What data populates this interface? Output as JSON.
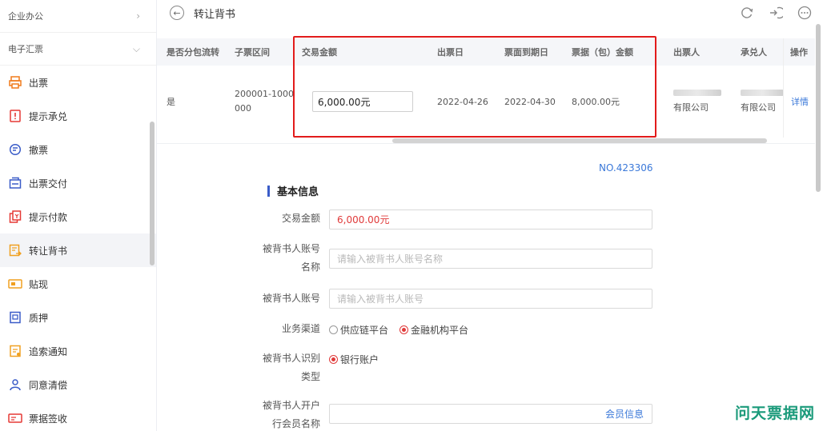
{
  "sidebar": {
    "groups": [
      {
        "label": "企业办公",
        "chevron": "›"
      },
      {
        "label": "电子汇票",
        "chevron": "⌄"
      }
    ],
    "items": [
      {
        "label": "出票",
        "icon": "printer-icon"
      },
      {
        "label": "提示承兑",
        "icon": "alert-doc-icon"
      },
      {
        "label": "撤票",
        "icon": "revoke-icon"
      },
      {
        "label": "出票交付",
        "icon": "deliver-icon"
      },
      {
        "label": "提示付款",
        "icon": "payment-icon"
      },
      {
        "label": "转让背书",
        "icon": "endorse-icon"
      },
      {
        "label": "贴现",
        "icon": "discount-icon"
      },
      {
        "label": "质押",
        "icon": "pledge-icon"
      },
      {
        "label": "追索通知",
        "icon": "recourse-icon"
      },
      {
        "label": "同意清偿",
        "icon": "agree-icon"
      },
      {
        "label": "票据签收",
        "icon": "sign-icon"
      }
    ],
    "active_index": 5
  },
  "header": {
    "title": "转让背书",
    "back": "←"
  },
  "table": {
    "columns": [
      "是否分包流转",
      "子票区间",
      "交易金额",
      "出票日",
      "票面到期日",
      "票据（包）金额",
      "出票人",
      "承兑人",
      "操作"
    ],
    "row": {
      "split": "是",
      "range_line1": "200001-1000",
      "range_line2": "000",
      "amount": "6,000.00元",
      "issue_date": "2022-04-26",
      "due_date": "2022-04-30",
      "bill_amount": "8,000.00元",
      "drawer": "有限公司",
      "acceptor": "有限公司",
      "action": "详情"
    }
  },
  "form": {
    "no": "NO.423306",
    "section_title": "基本信息",
    "amount_label": "交易金额",
    "amount_value": "6,000.00元",
    "acct_name_label_1": "被背书人账号",
    "acct_name_label_2": "名称",
    "acct_name_placeholder": "请输入被背书人账号名称",
    "acct_no_label": "被背书人账号",
    "acct_no_placeholder": "请输入被背书人账号",
    "channel_label": "业务渠道",
    "channel_options": [
      "供应链平台",
      "金融机构平台"
    ],
    "channel_selected": 1,
    "id_type_label_1": "被背书人识别",
    "id_type_label_2": "类型",
    "id_type_option": "银行账户",
    "bank_label_1": "被背书人开户",
    "bank_label_2": "行会员名称",
    "member_info": "会员信息"
  },
  "watermark": "问天票据网",
  "colors": {
    "accent": "#3a78d9",
    "danger": "#e03a3a",
    "highlight_box": "#e21b1b",
    "brand_green": "#1a9a7a"
  }
}
